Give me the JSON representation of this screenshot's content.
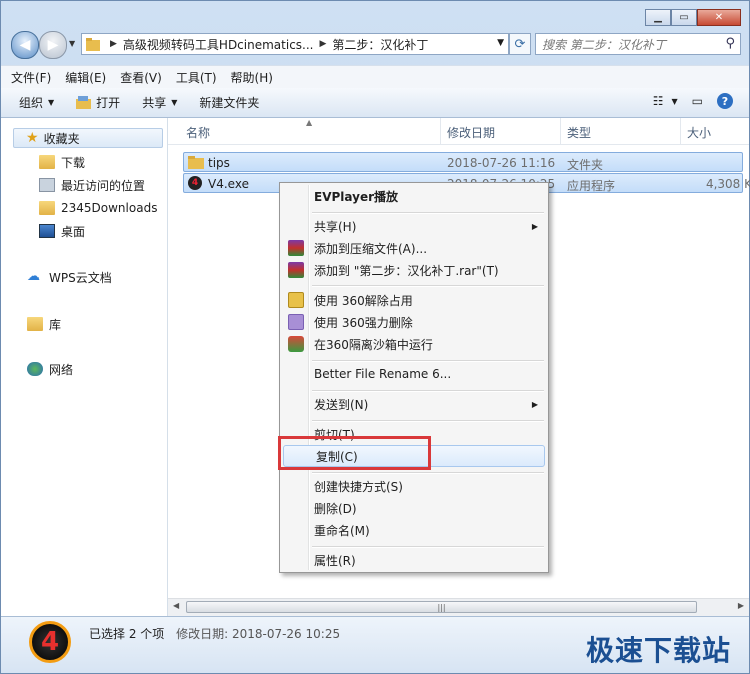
{
  "window": {
    "caption_buttons": [
      "minimize",
      "maximize",
      "close"
    ]
  },
  "address_bar": {
    "segments": [
      "高级视频转码工具HDcinematics...",
      "第二步：汉化补丁"
    ],
    "search_placeholder": "搜索 第二步：汉化补丁"
  },
  "menubar": {
    "items": [
      "文件(F)",
      "编辑(E)",
      "查看(V)",
      "工具(T)",
      "帮助(H)"
    ]
  },
  "toolbar": {
    "organize": "组织",
    "open": "打开",
    "share": "共享",
    "new_folder": "新建文件夹"
  },
  "navpane": {
    "favorites": "收藏夹",
    "favorites_items": [
      "下载",
      "最近访问的位置",
      "2345Downloads",
      "桌面"
    ],
    "wps": "WPS云文档",
    "library": "库",
    "network": "网络"
  },
  "filelist": {
    "columns": [
      "名称",
      "修改日期",
      "类型",
      "大小"
    ],
    "rows": [
      {
        "name": "tips",
        "date": "2018-07-26 11:16",
        "type": "文件夹",
        "size": ""
      },
      {
        "name": "V4.exe",
        "date": "2018-07-26 10:25",
        "type": "应用程序",
        "size": "4,308 K"
      }
    ]
  },
  "context_menu": {
    "items": [
      {
        "label": "EVPlayer播放",
        "bold": true
      },
      {
        "label": "共享(H)",
        "submenu": true
      },
      {
        "label": "添加到压缩文件(A)..."
      },
      {
        "label": "添加到 \"第二步：汉化补丁.rar\"(T)"
      },
      {
        "label": "使用 360解除占用"
      },
      {
        "label": "使用 360强力删除"
      },
      {
        "label": "在360隔离沙箱中运行"
      },
      {
        "label": "Better File Rename 6..."
      },
      {
        "label": "发送到(N)",
        "submenu": true
      },
      {
        "label": "剪切(T)"
      },
      {
        "label": "复制(C)",
        "highlighted": true
      },
      {
        "label": "创建快捷方式(S)"
      },
      {
        "label": "删除(D)"
      },
      {
        "label": "重命名(M)"
      },
      {
        "label": "属性(R)"
      }
    ]
  },
  "details": {
    "selection": "已选择 2 个项",
    "modified": "修改日期: 2018-07-26 10:25",
    "brand": "极速下载站"
  },
  "colors": {
    "highlight_box": "#d9383a",
    "selection_fill": "#cfe3fb",
    "brand": "#1b4f92"
  }
}
